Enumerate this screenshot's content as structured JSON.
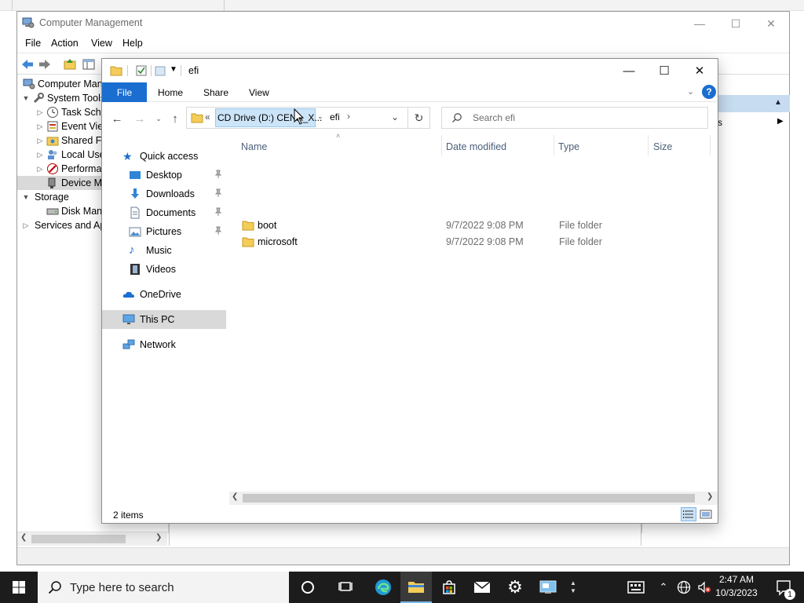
{
  "computer_management": {
    "title": "Computer Management",
    "menu": [
      "File",
      "Action",
      "View",
      "Help"
    ],
    "tree": [
      {
        "label": "Computer Management (Local)",
        "level": 0,
        "expander": ""
      },
      {
        "label": "System Tools",
        "level": 1,
        "expander": "open"
      },
      {
        "label": "Task Scheduler",
        "level": 2,
        "expander": "closed"
      },
      {
        "label": "Event Viewer",
        "level": 2,
        "expander": "closed"
      },
      {
        "label": "Shared Folders",
        "level": 2,
        "expander": "closed"
      },
      {
        "label": "Local Users and Groups",
        "level": 2,
        "expander": "closed"
      },
      {
        "label": "Performance",
        "level": 2,
        "expander": "closed"
      },
      {
        "label": "Device Manager",
        "level": 2,
        "expander": "",
        "selected": true
      },
      {
        "label": "Storage",
        "level": 1,
        "expander": "open"
      },
      {
        "label": "Disk Management",
        "level": 2,
        "expander": ""
      },
      {
        "label": "Services and Applications",
        "level": 1,
        "expander": "closed"
      }
    ],
    "actions_fragment": "s"
  },
  "explorer": {
    "title": "efi",
    "ribbon_tabs": [
      "File",
      "Home",
      "Share",
      "View"
    ],
    "address": {
      "overflow": "«",
      "segment_1": "CD Drive (D:) CENA_X...",
      "segment_2": "efi"
    },
    "search_placeholder": "Search efi",
    "nav": {
      "quick_access": "Quick access",
      "desktop": "Desktop",
      "downloads": "Downloads",
      "documents": "Documents",
      "pictures": "Pictures",
      "music": "Music",
      "videos": "Videos",
      "onedrive": "OneDrive",
      "this_pc": "This PC",
      "network": "Network"
    },
    "columns": {
      "name": "Name",
      "date": "Date modified",
      "type": "Type",
      "size": "Size"
    },
    "files": [
      {
        "name": "boot",
        "date": "9/7/2022 9:08 PM",
        "type": "File folder"
      },
      {
        "name": "microsoft",
        "date": "9/7/2022 9:08 PM",
        "type": "File folder"
      }
    ],
    "status": "2 items"
  },
  "taskbar": {
    "search_placeholder": "Type here to search",
    "time": "2:47 AM",
    "date": "10/3/2023",
    "notification_count": "1"
  },
  "colors": {
    "accent": "#1a6ed0",
    "folder": "#f4cd59",
    "selection": "#cce4f7"
  }
}
